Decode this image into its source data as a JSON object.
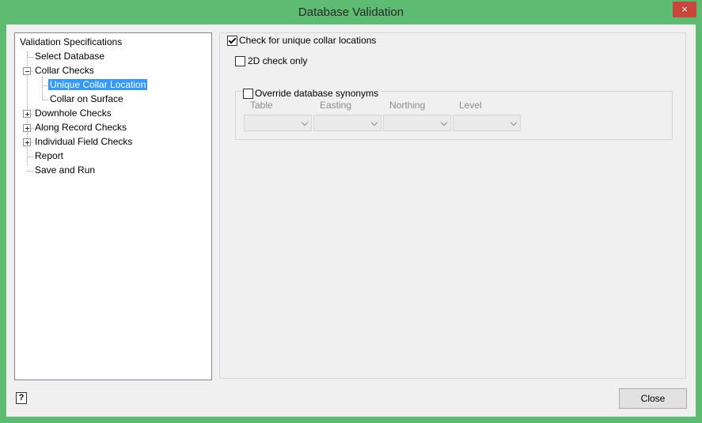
{
  "window": {
    "title": "Database Validation",
    "close_glyph": "×"
  },
  "tree": {
    "root": "Validation Specifications",
    "items": [
      {
        "label": "Select Database"
      },
      {
        "label": "Collar Checks",
        "children": [
          "Unique Collar Location",
          "Collar on Surface"
        ]
      },
      {
        "label": "Downhole Checks"
      },
      {
        "label": "Along Record Checks"
      },
      {
        "label": "Individual Field Checks"
      },
      {
        "label": "Report"
      },
      {
        "label": "Save and Run"
      }
    ]
  },
  "panel": {
    "unique_check": {
      "label": "Check for unique collar locations",
      "checked": true
    },
    "check_2d": {
      "label": "2D check only",
      "checked": false
    },
    "override": {
      "label": "Override database synonyms",
      "checked": false
    },
    "columns": [
      "Table",
      "Easting",
      "Northing",
      "Level"
    ]
  },
  "footer": {
    "help_glyph": "?",
    "help_icon": "help-icon",
    "close_label": "Close"
  }
}
